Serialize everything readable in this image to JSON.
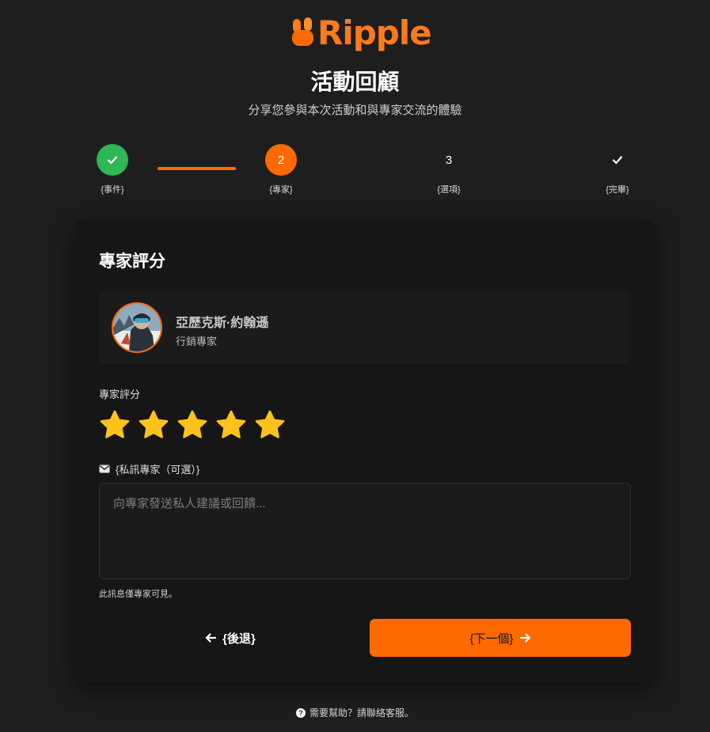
{
  "brand": {
    "name": "Ripple",
    "color": "#ff7a1a"
  },
  "header": {
    "title": "活動回顧",
    "subtitle": "分享您參與本次活動和與專家交流的體驗"
  },
  "steps": [
    {
      "label": "{事件}",
      "state": "done",
      "icon": "check-icon"
    },
    {
      "label": "{專家}",
      "state": "current",
      "number": "2"
    },
    {
      "label": "{選項}",
      "state": "upcoming",
      "number": "3"
    },
    {
      "label": "{完畢}",
      "state": "upcoming",
      "icon": "check-icon"
    }
  ],
  "card": {
    "title": "專家評分",
    "expert": {
      "name": "亞歷克斯·約翰遜",
      "role": "行銷專家"
    },
    "rating": {
      "label": "專家評分",
      "value": 5,
      "max": 5,
      "color": "#ffc21a"
    },
    "message": {
      "label": "{私訊專家（可選）}",
      "icon": "envelope-icon",
      "placeholder": "向專家發送私人建議或回饋...",
      "value": "",
      "note": "此訊息僅專家可見。"
    },
    "back_label": "{後退}",
    "next_label": "{下一個}"
  },
  "help": {
    "text": "需要幫助？請聯絡客服。",
    "icon": "question-icon"
  },
  "colors": {
    "accent": "#ff6a00",
    "success": "#2db855",
    "background": "#1e1e1e",
    "card": "#161616"
  }
}
